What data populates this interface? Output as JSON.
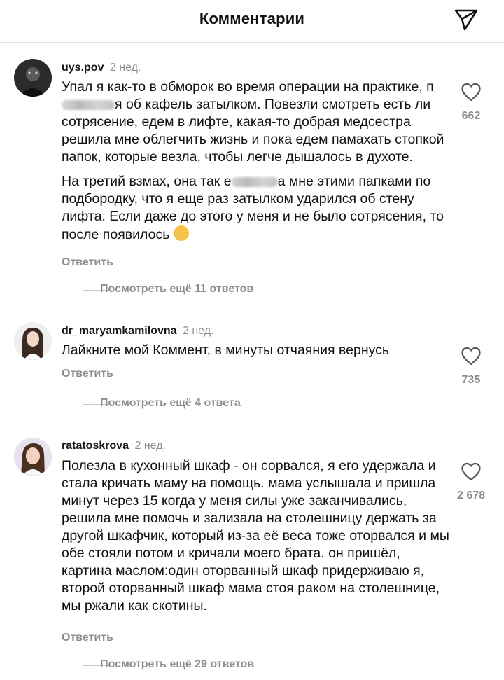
{
  "header": {
    "title": "Комментарии",
    "share_icon": "paper-plane-icon"
  },
  "comments": [
    {
      "username": "uys.pov",
      "time": "2 нед.",
      "paragraphs": [
        {
          "seg1": "Упал я как-то в обморок во время операции на практике,  п",
          "seg2": "я об кафель затылком. Повезли смотреть есть ли сотрясение, едем в лифте, какая-то добрая медсестра решила мне облегчить жизнь и пока едем памахать стопкой папок, которые везла, чтобы легче дышалось в духоте."
        },
        {
          "seg1": "На третий взмах, она так е",
          "seg2": "а мне этими папками по подбородку, что я еще раз затылком ударился об стену лифта.  Если даже до этого у меня и не было сотрясения, то после появилось"
        }
      ],
      "reply_label": "Ответить",
      "view_replies": "Посмотреть ещё 11 ответов",
      "likes": "662"
    },
    {
      "username": "dr_maryamkamilovna",
      "time": "2 нед.",
      "text": "Лайкните мой Коммент, в минуты отчаяния вернусь",
      "reply_label": "Ответить",
      "view_replies": "Посмотреть ещё 4 ответа",
      "likes": "735"
    },
    {
      "username": "ratatoskrova",
      "time": "2 нед.",
      "text": "Полезла в кухонный шкаф - он сорвался, я его удержала и стала кричать маму на помощь. мама услышала и пришла минут через 15 когда у меня силы уже заканчивались, решила мне помочь и зализала на столешницу держать за другой шкафчик, который из-за её веса тоже оторвался и мы обе стояли потом и кричали моего брата. он пришёл, картина маслом:один  оторванный шкаф придерживаю я, второй оторванный шкаф мама стоя раком на столешнице, мы ржали как скотины.",
      "reply_label": "Ответить",
      "view_replies": "Посмотреть ещё 29 ответов",
      "likes": "2 678"
    }
  ]
}
